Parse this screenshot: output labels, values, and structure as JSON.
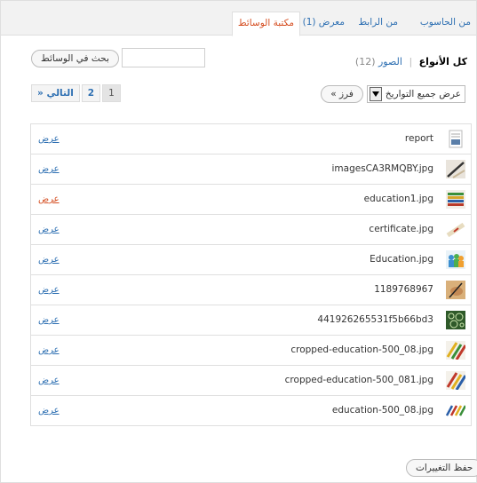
{
  "tabs": [
    {
      "label": "من الحاسوب",
      "active": false
    },
    {
      "label": "من الرابط",
      "active": false
    },
    {
      "label": "معرض (1)",
      "active": false
    },
    {
      "label": "مكتبة الوسائط",
      "active": true
    }
  ],
  "search": {
    "button_label": "بحث في الوسائط",
    "value": ""
  },
  "filters": {
    "all_types": "كل الأنواع",
    "separator": "|",
    "images_label": "الصور",
    "images_count": "(12)"
  },
  "date_filter": {
    "selected": "عرض جميع التواريخ",
    "sort_button": "فرز »"
  },
  "pagination": {
    "current": "1",
    "page2": "2",
    "next": "» التالي"
  },
  "items": [
    {
      "name": "report",
      "action": "عرض",
      "thumb": "document"
    },
    {
      "name": "imagesCA3RMQBY.jpg",
      "action": "عرض",
      "thumb": "pen"
    },
    {
      "name": "education1.jpg",
      "action": "عرض",
      "thumb": "books"
    },
    {
      "name": "certificate.jpg",
      "action": "عرض",
      "thumb": "scroll"
    },
    {
      "name": "Education.jpg",
      "action": "عرض",
      "thumb": "people"
    },
    {
      "name": "1189768967",
      "action": "عرض",
      "thumb": "hand-writing"
    },
    {
      "name": "441926265531f5b66bd3",
      "action": "عرض",
      "thumb": "pattern"
    },
    {
      "name": "cropped-education-500_08.jpg",
      "action": "عرض",
      "thumb": "pencils"
    },
    {
      "name": "cropped-education-500_081.jpg",
      "action": "عرض",
      "thumb": "pencils"
    },
    {
      "name": "education-500_08.jpg",
      "action": "عرض",
      "thumb": "pencils"
    }
  ],
  "save_button": "حفظ التغييرات",
  "colors": {
    "link": "#2d6fb2",
    "active_tab": "#d54e21",
    "border": "#dfdfdf"
  }
}
